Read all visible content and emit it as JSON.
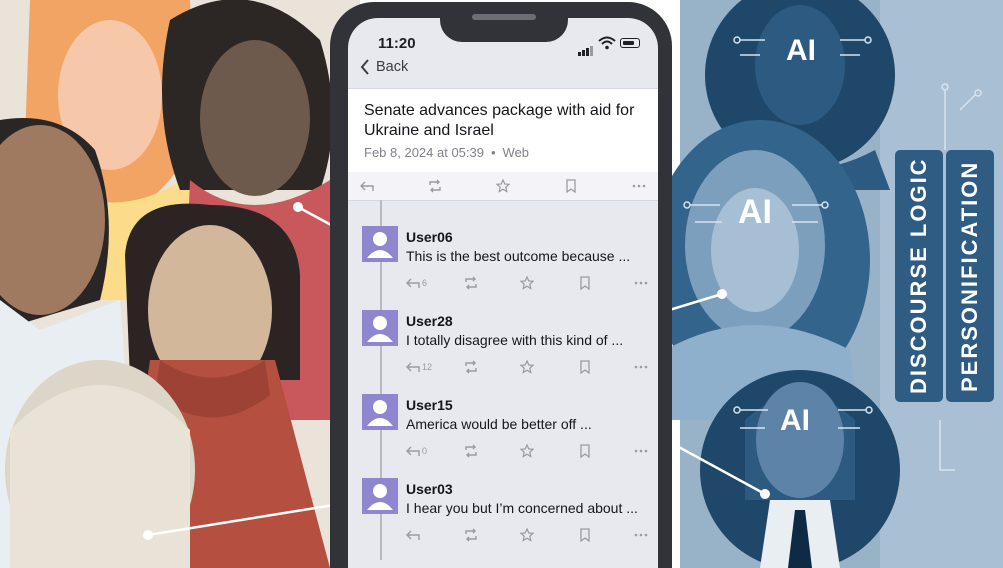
{
  "status_bar": {
    "time": "11:20"
  },
  "nav": {
    "back_label": "Back"
  },
  "post": {
    "title": "Senate advances package with aid for Ukraine and Israel",
    "date": "Feb 8, 2024 at 05:39",
    "source": "Web"
  },
  "replies": [
    {
      "user": "User06",
      "text": "This is the best outcome because ...",
      "reply_count": "6"
    },
    {
      "user": "User28",
      "text": "I totally disagree with this kind of ...",
      "reply_count": "12"
    },
    {
      "user": "User15",
      "text": "America would be better off ...",
      "reply_count": "0"
    },
    {
      "user": "User03",
      "text": "I hear you but I’m concerned about ...",
      "reply_count": ""
    }
  ],
  "ai_badges": [
    "AI",
    "AI",
    "AI"
  ],
  "side_labels": {
    "left": "DISCOURSE LOGIC",
    "right": "PERSONIFICATION"
  },
  "colors": {
    "avatar": "#8e87cf",
    "phone_frame": "#323338",
    "screen_bg": "#e8e8ef",
    "ai_panel": "#98b2c8",
    "ai_dark": "#1f4769"
  },
  "icons": [
    "chevron-left-icon",
    "reply-icon",
    "retweet-icon",
    "star-icon",
    "bookmark-icon",
    "more-icon",
    "user-icon",
    "wifi-icon",
    "battery-icon",
    "signal-icon",
    "circuit-icon"
  ]
}
